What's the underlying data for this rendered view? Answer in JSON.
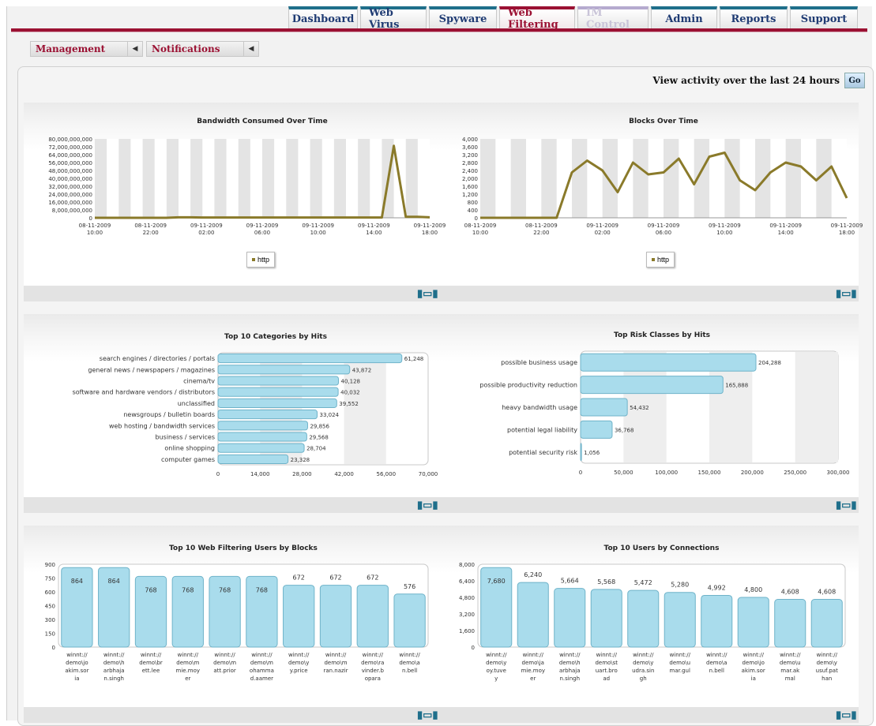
{
  "nav": {
    "tabs": [
      {
        "label": "Dashboard",
        "state": "normal"
      },
      {
        "label": "Web Virus",
        "state": "normal"
      },
      {
        "label": "Spyware",
        "state": "normal"
      },
      {
        "label": "Web Filtering",
        "state": "active"
      },
      {
        "label": "IM Control",
        "state": "disabled"
      },
      {
        "label": "Admin",
        "state": "normal"
      },
      {
        "label": "Reports",
        "state": "normal"
      },
      {
        "label": "Support",
        "state": "normal"
      }
    ]
  },
  "subnav": {
    "items": [
      {
        "label": "Management"
      },
      {
        "label": "Notifications"
      }
    ]
  },
  "viewbar": {
    "label": "View activity over the last 24 hours",
    "go": "Go"
  },
  "colors": {
    "brand_red": "#9b1133",
    "line": "#8a7a2a",
    "bar": "#a9dcec",
    "tab_blue": "#1f6f8b"
  },
  "legend_label": "http",
  "chart_data": [
    {
      "type": "line",
      "title": "Bandwidth Consumed Over Time",
      "x": [
        "08-11-2009\n10:00",
        "08-11-2009\n22:00",
        "09-11-2009\n02:00",
        "09-11-2009\n06:00",
        "09-11-2009\n10:00",
        "09-11-2009\n14:00",
        "09-11-2009\n18:00"
      ],
      "yticks": [
        "0",
        "8,000,000,000",
        "16,000,000,000",
        "24,000,000,000",
        "32,000,000,000",
        "40,000,000,000",
        "48,000,000,000",
        "56,000,000,000",
        "64,000,000,000",
        "72,000,000,000",
        "80,000,000,000"
      ],
      "ylim": [
        0,
        80000000000
      ],
      "series": [
        {
          "name": "http",
          "values": [
            0,
            0,
            0,
            0,
            0,
            0,
            0,
            500000000,
            500000000,
            300000000,
            300000000,
            300000000,
            300000000,
            300000000,
            300000000,
            300000000,
            300000000,
            300000000,
            300000000,
            300000000,
            300000000,
            300000000,
            300000000,
            300000000,
            300000000,
            73000000000,
            1000000000,
            1000000000,
            500000000
          ]
        }
      ],
      "legend": "bottom"
    },
    {
      "type": "line",
      "title": "Blocks Over Time",
      "x": [
        "08-11-2009\n10:00",
        "08-11-2009\n22:00",
        "09-11-2009\n02:00",
        "09-11-2009\n06:00",
        "09-11-2009\n10:00",
        "09-11-2009\n14:00",
        "09-11-2009\n18:00"
      ],
      "yticks": [
        "0",
        "400",
        "800",
        "1,200",
        "1,600",
        "2,000",
        "2,400",
        "2,800",
        "3,200",
        "3,600",
        "4,000"
      ],
      "ylim": [
        0,
        4000
      ],
      "series": [
        {
          "name": "http",
          "values": [
            0,
            0,
            0,
            0,
            0,
            0,
            2300,
            2900,
            2400,
            1300,
            2800,
            2200,
            2300,
            3000,
            1700,
            3100,
            3300,
            1900,
            1400,
            2300,
            2800,
            2600,
            1900,
            2600,
            1000
          ]
        }
      ],
      "legend": "bottom"
    },
    {
      "type": "bar",
      "orientation": "horizontal",
      "title": "Top 10 Categories by Hits",
      "categories": [
        "search engines / directories / portals",
        "general news / newspapers / magazines",
        "cinema/tv",
        "software and hardware vendors / distributors",
        "unclassified",
        "newsgroups / bulletin boards",
        "web hosting / bandwidth services",
        "business / services",
        "online shopping",
        "computer games"
      ],
      "values": [
        61248,
        43872,
        40128,
        40032,
        39552,
        33024,
        29856,
        29568,
        28704,
        23328
      ],
      "value_labels": [
        "61,248",
        "43,872",
        "40,128",
        "40,032",
        "39,552",
        "33,024",
        "29,856",
        "29,568",
        "28,704",
        "23,328"
      ],
      "xticks": [
        "0",
        "14,000",
        "28,000",
        "42,000",
        "56,000",
        "70,000"
      ],
      "xlim": [
        0,
        70000
      ]
    },
    {
      "type": "bar",
      "orientation": "horizontal",
      "title": "Top Risk Classes by Hits",
      "categories": [
        "possible business usage",
        "possible productivity reduction",
        "heavy bandwidth usage",
        "potential legal liability",
        "potential security risk"
      ],
      "values": [
        204288,
        165888,
        54432,
        36768,
        1056
      ],
      "value_labels": [
        "204,288",
        "165,888",
        "54,432",
        "36,768",
        "1,056"
      ],
      "xticks": [
        "0",
        "50,000",
        "100,000",
        "150,000",
        "200,000",
        "250,000",
        "300,000"
      ],
      "xlim": [
        0,
        300000
      ]
    },
    {
      "type": "bar",
      "orientation": "vertical",
      "title": "Top 10 Web Filtering Users by Blocks",
      "categories": [
        "winnt://\ndemo\\jo\nakim.sor\nia",
        "winnt://\ndemo\\h\narbhaja\nn.singh",
        "winnt://\ndemo\\br\nett.lee",
        "winnt://\ndemo\\m\nmie.moy\ner",
        "winnt://\ndemo\\m\natt.prior",
        "winnt://\ndemo\\m\nohamma\nd.aamer",
        "winnt://\ndemo\\y\ny.price",
        "winnt://\ndemo\\m\nran.nazir",
        "winnt://\ndemo\\ra\nvinder.b\nopara",
        "winnt://\ndemo\\a\nn.bell"
      ],
      "values": [
        864,
        864,
        768,
        768,
        768,
        768,
        672,
        672,
        672,
        576
      ],
      "value_labels": [
        "864",
        "864",
        "768",
        "768",
        "768",
        "768",
        "672",
        "672",
        "672",
        "576"
      ],
      "yticks": [
        "0",
        "150",
        "300",
        "450",
        "600",
        "750",
        "900"
      ],
      "ylim": [
        0,
        900
      ]
    },
    {
      "type": "bar",
      "orientation": "vertical",
      "title": "Top 10 Users by Connections",
      "categories": [
        "winnt://\ndemo\\y\noy.tuve\ny",
        "winnt://\ndemo\\ja\nmie.moy\ner",
        "winnt://\ndemo\\h\narbhaja\nn.singh",
        "winnt://\ndemo\\st\nuart.bro\nad",
        "winnt://\ndemo\\y\nudra.sin\ngh",
        "winnt://\ndemo\\u\nmar.gul",
        "winnt://\ndemo\\a\nn.bell",
        "winnt://\ndemo\\jo\nakim.sor\nia",
        "winnt://\ndemo\\u\nmar.ak\nmal",
        "winnt://\ndemo\\y\nusuf.pat\nhan"
      ],
      "values": [
        7680,
        6240,
        5664,
        5568,
        5472,
        5280,
        4992,
        4800,
        4608,
        4608
      ],
      "value_labels": [
        "7,680",
        "6,240",
        "5,664",
        "5,568",
        "5,472",
        "5,280",
        "4,992",
        "4,800",
        "4,608",
        "4,608"
      ],
      "yticks": [
        "0",
        "1,600",
        "3,200",
        "4,800",
        "6,400",
        "8,000"
      ],
      "ylim": [
        0,
        8000
      ]
    }
  ]
}
